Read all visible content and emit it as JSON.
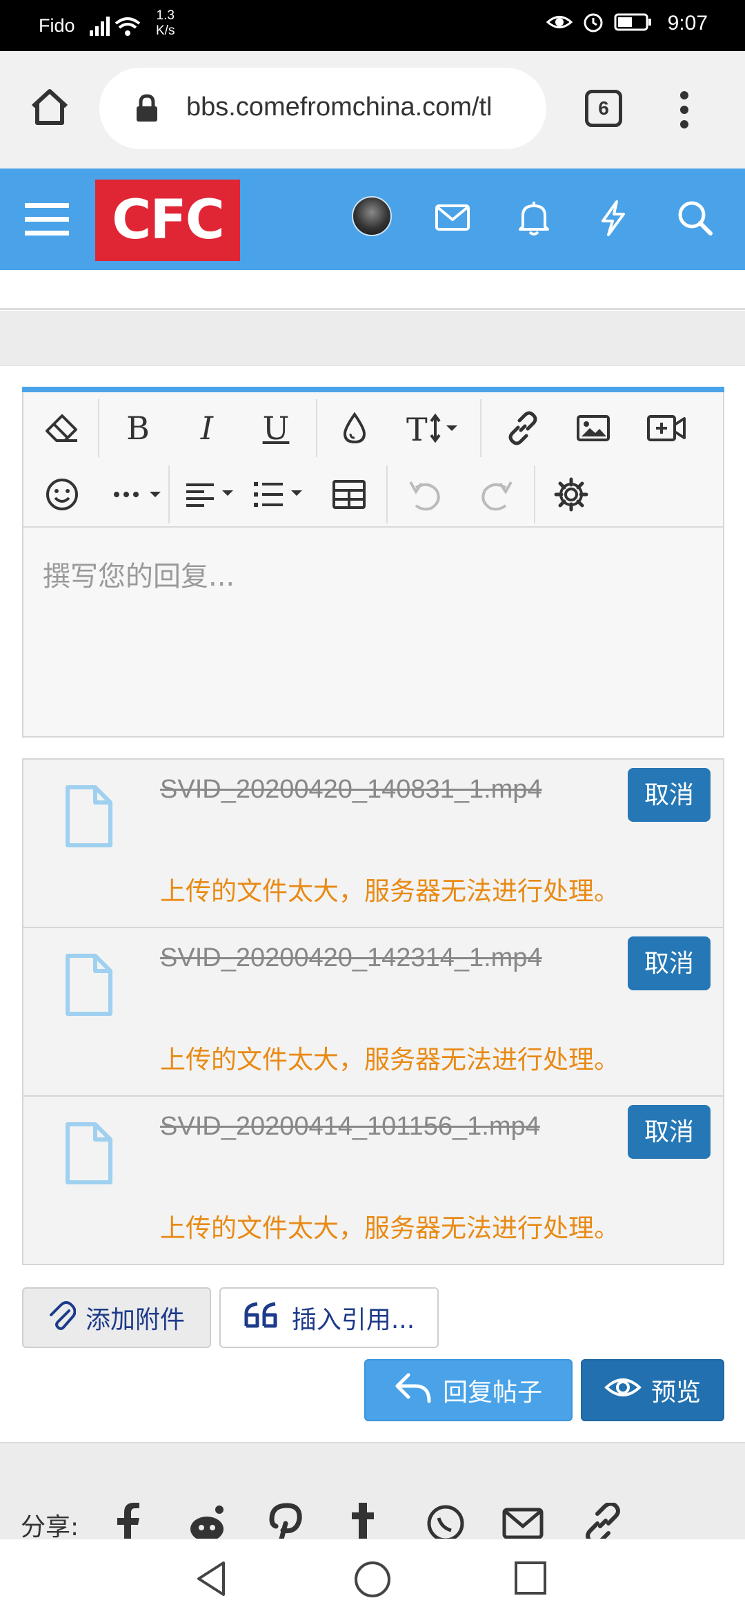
{
  "status_bar": {
    "carrier": "Fido",
    "speed_top": "1.3",
    "speed_bottom": "K/s",
    "time": "9:07"
  },
  "browser": {
    "url": "bbs.comefromchina.com/tl",
    "tab_count": "6"
  },
  "site": {
    "logo_text": "CFC"
  },
  "editor": {
    "placeholder": "撰写您的回复..."
  },
  "attachments": [
    {
      "filename": "SVID_20200420_140831_1.mp4",
      "error": "上传的文件太大，服务器无法进行处理。",
      "cancel_label": "取消"
    },
    {
      "filename": "SVID_20200420_142314_1.mp4",
      "error": "上传的文件太大，服务器无法进行处理。",
      "cancel_label": "取消"
    },
    {
      "filename": "SVID_20200414_101156_1.mp4",
      "error": "上传的文件太大，服务器无法进行处理。",
      "cancel_label": "取消"
    }
  ],
  "actions": {
    "attach_label": "添加附件",
    "quote_label": "插入引用...",
    "reply_label": "回复帖子",
    "preview_label": "预览"
  },
  "share": {
    "label": "分享:"
  },
  "colors": {
    "header_blue": "#4aa3e8",
    "logo_red": "#e02535",
    "dark_blue": "#2270b0",
    "warning_orange": "#e88a14"
  }
}
